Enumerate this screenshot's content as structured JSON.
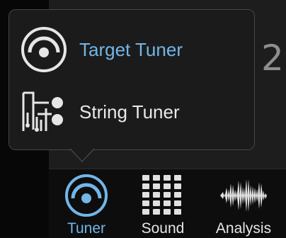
{
  "background": {
    "partial_reading": "2"
  },
  "popup_menu": {
    "items": [
      {
        "label": "Target Tuner",
        "icon": "target-tuner-icon",
        "selected": true
      },
      {
        "label": "String Tuner",
        "icon": "string-tuner-icon",
        "selected": false
      }
    ]
  },
  "tab_bar": {
    "tabs": [
      {
        "label": "Tuner",
        "icon": "tuner-icon",
        "active": true
      },
      {
        "label": "Sound",
        "icon": "keypad-grid-icon",
        "active": false
      },
      {
        "label": "Analysis",
        "icon": "waveform-icon",
        "active": false
      }
    ]
  },
  "colors": {
    "accent": "#72b6e8",
    "text": "#e6e6e6",
    "background": "#1d1d1d",
    "popup_background": "#1b1b1b"
  }
}
